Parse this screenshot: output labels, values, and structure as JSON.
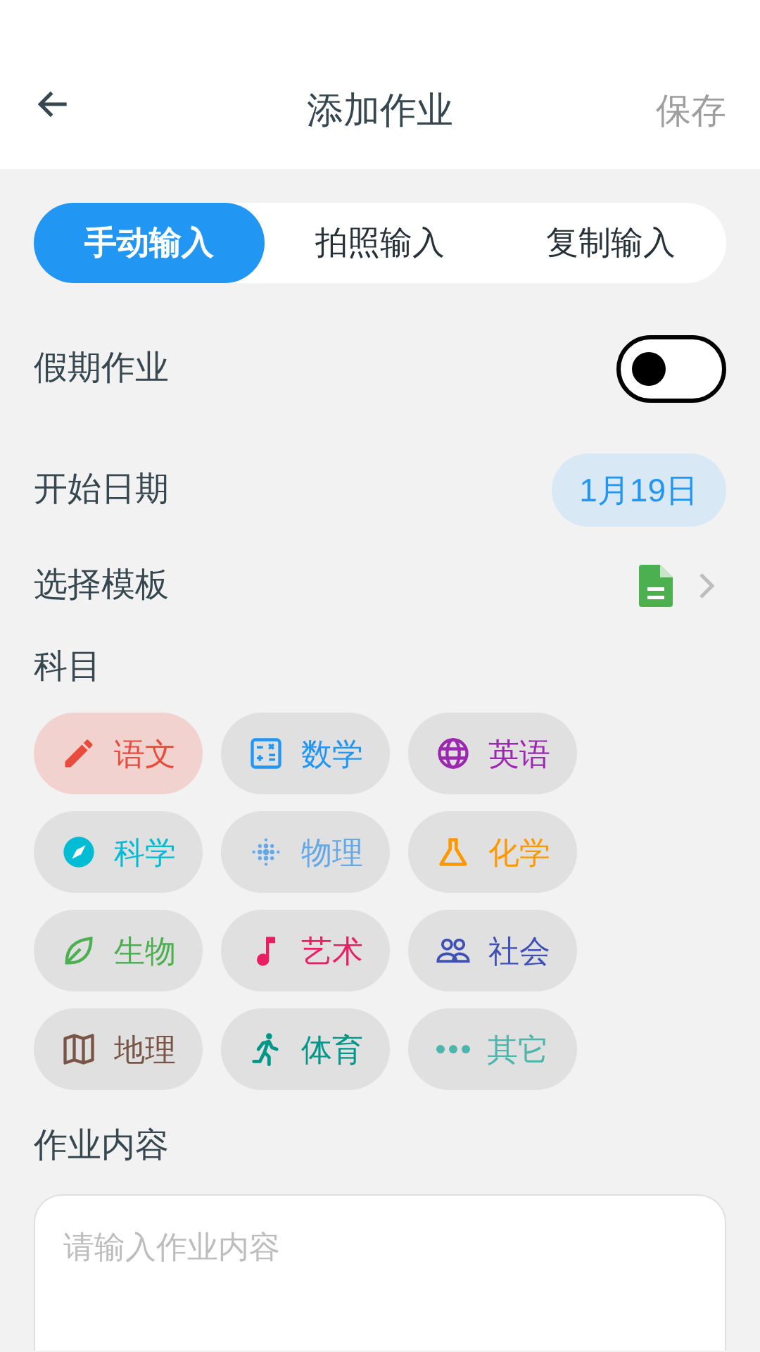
{
  "header": {
    "title": "添加作业",
    "save": "保存"
  },
  "tabs": [
    {
      "label": "手动输入",
      "selected": true
    },
    {
      "label": "拍照输入",
      "selected": false
    },
    {
      "label": "复制输入",
      "selected": false
    }
  ],
  "holiday": {
    "label": "假期作业",
    "on": false
  },
  "start_date": {
    "label": "开始日期",
    "value": "1月19日"
  },
  "template": {
    "label": "选择模板"
  },
  "subjects_label": "科目",
  "subjects": [
    {
      "label": "语文",
      "color": "#e74c3c",
      "selected": true
    },
    {
      "label": "数学",
      "color": "#2196f3",
      "selected": false
    },
    {
      "label": "英语",
      "color": "#9c27b0",
      "selected": false
    },
    {
      "label": "科学",
      "color": "#00bcd4",
      "selected": false
    },
    {
      "label": "物理",
      "color": "#64a8e8",
      "selected": false
    },
    {
      "label": "化学",
      "color": "#ff9800",
      "selected": false
    },
    {
      "label": "生物",
      "color": "#4caf50",
      "selected": false
    },
    {
      "label": "艺术",
      "color": "#e91e63",
      "selected": false
    },
    {
      "label": "社会",
      "color": "#3f51b5",
      "selected": false
    },
    {
      "label": "地理",
      "color": "#795548",
      "selected": false
    },
    {
      "label": "体育",
      "color": "#009688",
      "selected": false
    },
    {
      "label": "其它",
      "color": "#4db6ac",
      "selected": false
    }
  ],
  "content": {
    "label": "作业内容",
    "placeholder": "请输入作业内容"
  }
}
